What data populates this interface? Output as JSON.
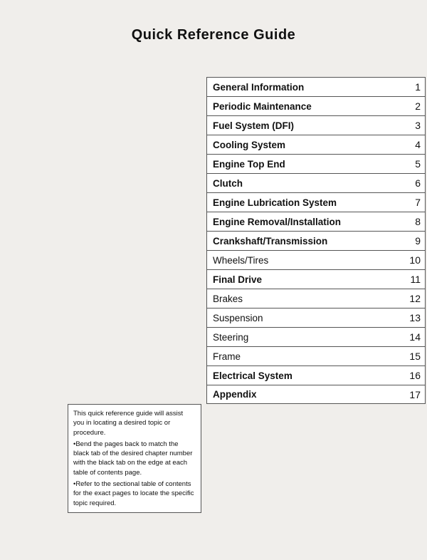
{
  "page": {
    "title": "Quick Reference Guide",
    "toc": [
      {
        "label": "General Information",
        "number": "1",
        "bold": true
      },
      {
        "label": "Periodic Maintenance",
        "number": "2",
        "bold": true
      },
      {
        "label": "Fuel System (DFI)",
        "number": "3",
        "bold": true
      },
      {
        "label": "Cooling System",
        "number": "4",
        "bold": true
      },
      {
        "label": "Engine Top End",
        "number": "5",
        "bold": true
      },
      {
        "label": "Clutch",
        "number": "6",
        "bold": true
      },
      {
        "label": "Engine Lubrication System",
        "number": "7",
        "bold": true
      },
      {
        "label": "Engine Removal/Installation",
        "number": "8",
        "bold": true
      },
      {
        "label": "Crankshaft/Transmission",
        "number": "9",
        "bold": true
      },
      {
        "label": "Wheels/Tires",
        "number": "10",
        "bold": false
      },
      {
        "label": "Final Drive",
        "number": "11",
        "bold": true
      },
      {
        "label": "Brakes",
        "number": "12",
        "bold": false
      },
      {
        "label": "Suspension",
        "number": "13",
        "bold": false
      },
      {
        "label": "Steering",
        "number": "14",
        "bold": false
      },
      {
        "label": "Frame",
        "number": "15",
        "bold": false
      },
      {
        "label": "Electrical System",
        "number": "16",
        "bold": true
      },
      {
        "label": "Appendix",
        "number": "17",
        "bold": true
      }
    ],
    "note": {
      "line1": "This quick reference guide will assist you in locating a desired topic or procedure.",
      "line2": "•Bend the pages back to match the black tab of the desired chapter number with the black tab on the edge at each table of contents page.",
      "line3": "•Refer to the sectional table of contents for the exact pages to locate the specific topic required."
    }
  }
}
